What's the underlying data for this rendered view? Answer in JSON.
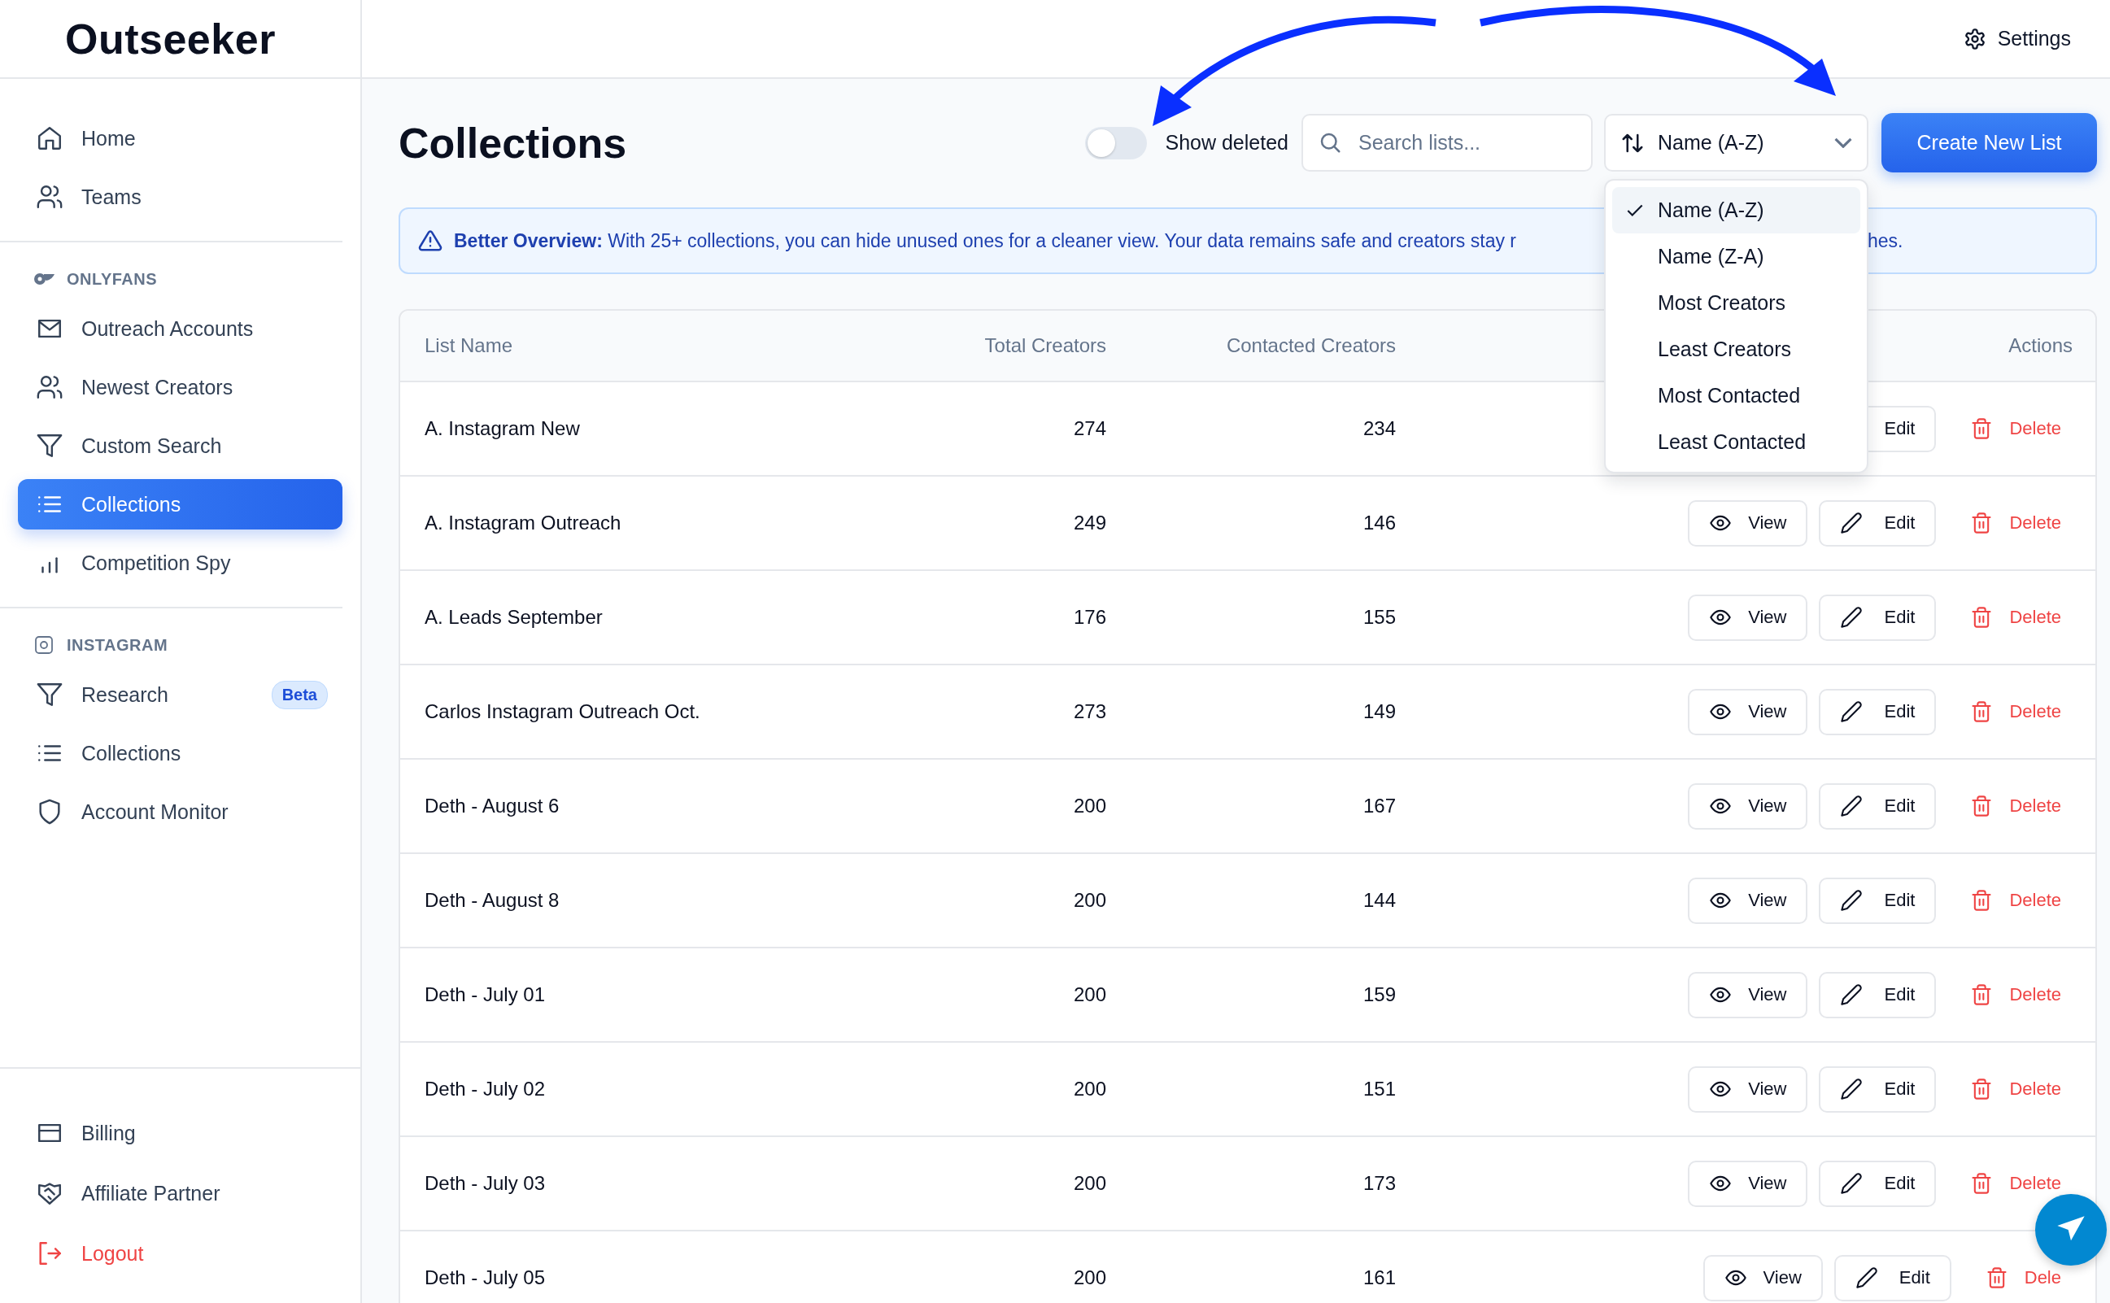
{
  "logo": "Outseeker",
  "header": {
    "settings": "Settings"
  },
  "sidebar": {
    "top_items": [
      {
        "label": "Home",
        "selected": false
      },
      {
        "label": "Teams",
        "selected": false
      }
    ],
    "sections": [
      {
        "title": "ONLYFANS",
        "items": [
          {
            "label": "Outreach Accounts",
            "selected": false
          },
          {
            "label": "Newest Creators",
            "selected": false
          },
          {
            "label": "Custom Search",
            "selected": false
          },
          {
            "label": "Collections",
            "selected": true
          },
          {
            "label": "Competition Spy",
            "selected": false
          }
        ]
      },
      {
        "title": "INSTAGRAM",
        "items": [
          {
            "label": "Research",
            "selected": false,
            "badge": "Beta"
          },
          {
            "label": "Collections",
            "selected": false
          },
          {
            "label": "Account Monitor",
            "selected": false
          }
        ]
      }
    ],
    "bottom_items": [
      {
        "label": "Billing",
        "kind": "link"
      },
      {
        "label": "Affiliate Partner",
        "kind": "link"
      },
      {
        "label": "Logout",
        "kind": "logout"
      }
    ]
  },
  "page": {
    "title": "Collections",
    "toggle": {
      "label": "Show deleted",
      "on": false
    },
    "search": {
      "placeholder": "Search lists..."
    },
    "sort": {
      "value": "Name (A-Z)",
      "open": true,
      "options": [
        {
          "label": "Name (A-Z)",
          "selected": true
        },
        {
          "label": "Name (Z-A)",
          "selected": false
        },
        {
          "label": "Most Creators",
          "selected": false
        },
        {
          "label": "Least Creators",
          "selected": false
        },
        {
          "label": "Most Contacted",
          "selected": false
        },
        {
          "label": "Least Contacted",
          "selected": false
        }
      ]
    },
    "create_button": "Create New List",
    "banner": {
      "text": "**Better Overview:** With 25+ collections, you can hide unused ones for a cleaner view. Your data remains safe and creators stay r",
      "tail": "hes."
    }
  },
  "table": {
    "columns": [
      "List Name",
      "Total Creators",
      "Contacted Creators",
      "Actions"
    ],
    "rows": [
      {
        "name": "A. Instagram New",
        "total": "274",
        "contacted": "234",
        "actions": [
          {
            "kind": "edit",
            "label": "Edit",
            "icon_hidden": true
          },
          {
            "kind": "delete",
            "label": "Delete"
          }
        ]
      },
      {
        "name": "A. Instagram Outreach",
        "total": "249",
        "contacted": "146",
        "actions": [
          {
            "kind": "view",
            "label": "View"
          },
          {
            "kind": "edit",
            "label": "Edit"
          },
          {
            "kind": "delete",
            "label": "Delete"
          }
        ]
      },
      {
        "name": "A. Leads September",
        "total": "176",
        "contacted": "155",
        "actions": [
          {
            "kind": "view",
            "label": "View"
          },
          {
            "kind": "edit",
            "label": "Edit"
          },
          {
            "kind": "delete",
            "label": "Delete"
          }
        ]
      },
      {
        "name": "Carlos Instagram Outreach Oct.",
        "total": "273",
        "contacted": "149",
        "actions": [
          {
            "kind": "view",
            "label": "View"
          },
          {
            "kind": "edit",
            "label": "Edit"
          },
          {
            "kind": "delete",
            "label": "Delete"
          }
        ]
      },
      {
        "name": "Deth - August 6",
        "total": "200",
        "contacted": "167",
        "actions": [
          {
            "kind": "view",
            "label": "View"
          },
          {
            "kind": "edit",
            "label": "Edit"
          },
          {
            "kind": "delete",
            "label": "Delete"
          }
        ]
      },
      {
        "name": "Deth - August 8",
        "total": "200",
        "contacted": "144",
        "actions": [
          {
            "kind": "view",
            "label": "View"
          },
          {
            "kind": "edit",
            "label": "Edit"
          },
          {
            "kind": "delete",
            "label": "Delete"
          }
        ]
      },
      {
        "name": "Deth - July 01",
        "total": "200",
        "contacted": "159",
        "actions": [
          {
            "kind": "view",
            "label": "View"
          },
          {
            "kind": "edit",
            "label": "Edit"
          },
          {
            "kind": "delete",
            "label": "Delete"
          }
        ]
      },
      {
        "name": "Deth - July 02",
        "total": "200",
        "contacted": "151",
        "actions": [
          {
            "kind": "view",
            "label": "View"
          },
          {
            "kind": "edit",
            "label": "Edit"
          },
          {
            "kind": "delete",
            "label": "Delete"
          }
        ]
      },
      {
        "name": "Deth - July 03",
        "total": "200",
        "contacted": "173",
        "actions": [
          {
            "kind": "view",
            "label": "View"
          },
          {
            "kind": "edit",
            "label": "Edit"
          },
          {
            "kind": "delete",
            "label": "Delete"
          }
        ]
      },
      {
        "name": "Deth - July 05",
        "total": "200",
        "contacted": "161",
        "actions": [
          {
            "kind": "view",
            "label": "View"
          },
          {
            "kind": "edit",
            "label": "Edit"
          },
          {
            "kind": "delete",
            "label": "Dele"
          }
        ]
      }
    ]
  }
}
